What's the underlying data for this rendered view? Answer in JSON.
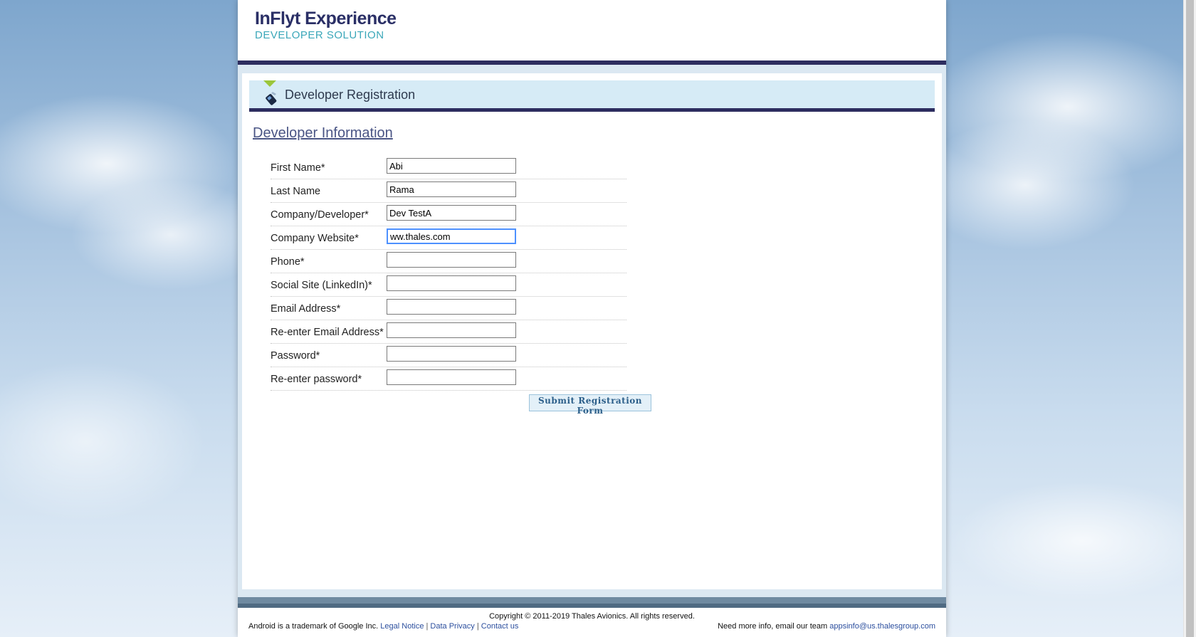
{
  "header": {
    "logo_title": "InFlyt Experience",
    "logo_subtitle": "DEVELOPER SOLUTION"
  },
  "section": {
    "title": "Developer Registration",
    "subheading": "Developer Information"
  },
  "form": {
    "fields": [
      {
        "label": "First Name*",
        "value": "Abi"
      },
      {
        "label": "Last Name",
        "value": "Rama"
      },
      {
        "label": "Company/Developer*",
        "value": "Dev TestA"
      },
      {
        "label": "Company Website*",
        "value": "ww.thales.com"
      },
      {
        "label": "Phone*",
        "value": ""
      },
      {
        "label": "Social Site (LinkedIn)*",
        "value": ""
      },
      {
        "label": "Email Address*",
        "value": ""
      },
      {
        "label": "Re-enter Email Address*",
        "value": ""
      },
      {
        "label": "Password*",
        "value": ""
      },
      {
        "label": "Re-enter password*",
        "value": ""
      }
    ],
    "submit_label": "Submit Registration Form"
  },
  "footer": {
    "copyright": "Copyright © 2011-2019 Thales Avionics. All rights reserved.",
    "trademark": "Android is a trademark of Google Inc.",
    "legal_notice": "Legal Notice",
    "data_privacy": "Data Privacy",
    "contact_us": "Contact us",
    "separator": "|",
    "info_text": "Need more info, email our team",
    "email": "appsinfo@us.thalesgroup.com"
  },
  "colors": {
    "brand_navy": "#2d2d5f",
    "brand_teal": "#3aa7b9",
    "accent_green": "#9bc63b",
    "link_blue": "#2c4f9e"
  },
  "icons": {
    "section": "pen-icon",
    "marker": "triangle-marker-icon"
  }
}
